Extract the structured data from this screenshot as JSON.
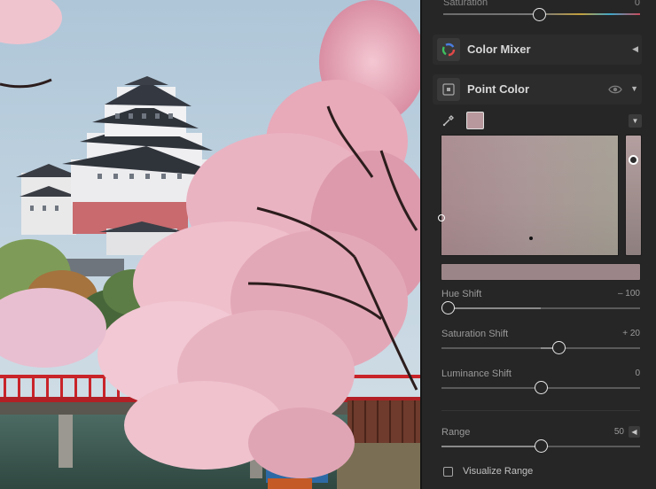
{
  "top_slider": {
    "label": "Saturation",
    "value": "0",
    "position": 0.49
  },
  "sections": {
    "color_mixer": {
      "title": "Color Mixer",
      "icon": "color-wheel-icon"
    },
    "point_color": {
      "title": "Point Color",
      "icon": "point-color-icon"
    }
  },
  "point_color": {
    "swatch_color": "#b8989c",
    "sliders": [
      {
        "label": "Hue Shift",
        "value": "– 100",
        "position": 0.0
      },
      {
        "label": "Saturation Shift",
        "value": "+ 20",
        "position": 0.6
      },
      {
        "label": "Luminance Shift",
        "value": "0",
        "position": 0.5
      },
      {
        "label": "Range",
        "value": "50",
        "position": 0.5
      }
    ],
    "visualize_range": {
      "label": "Visualize Range",
      "checked": false
    }
  },
  "colors": {
    "panel_bg": "#262626",
    "header_bg": "#2c2c2c",
    "text": "#d8d8d8"
  }
}
